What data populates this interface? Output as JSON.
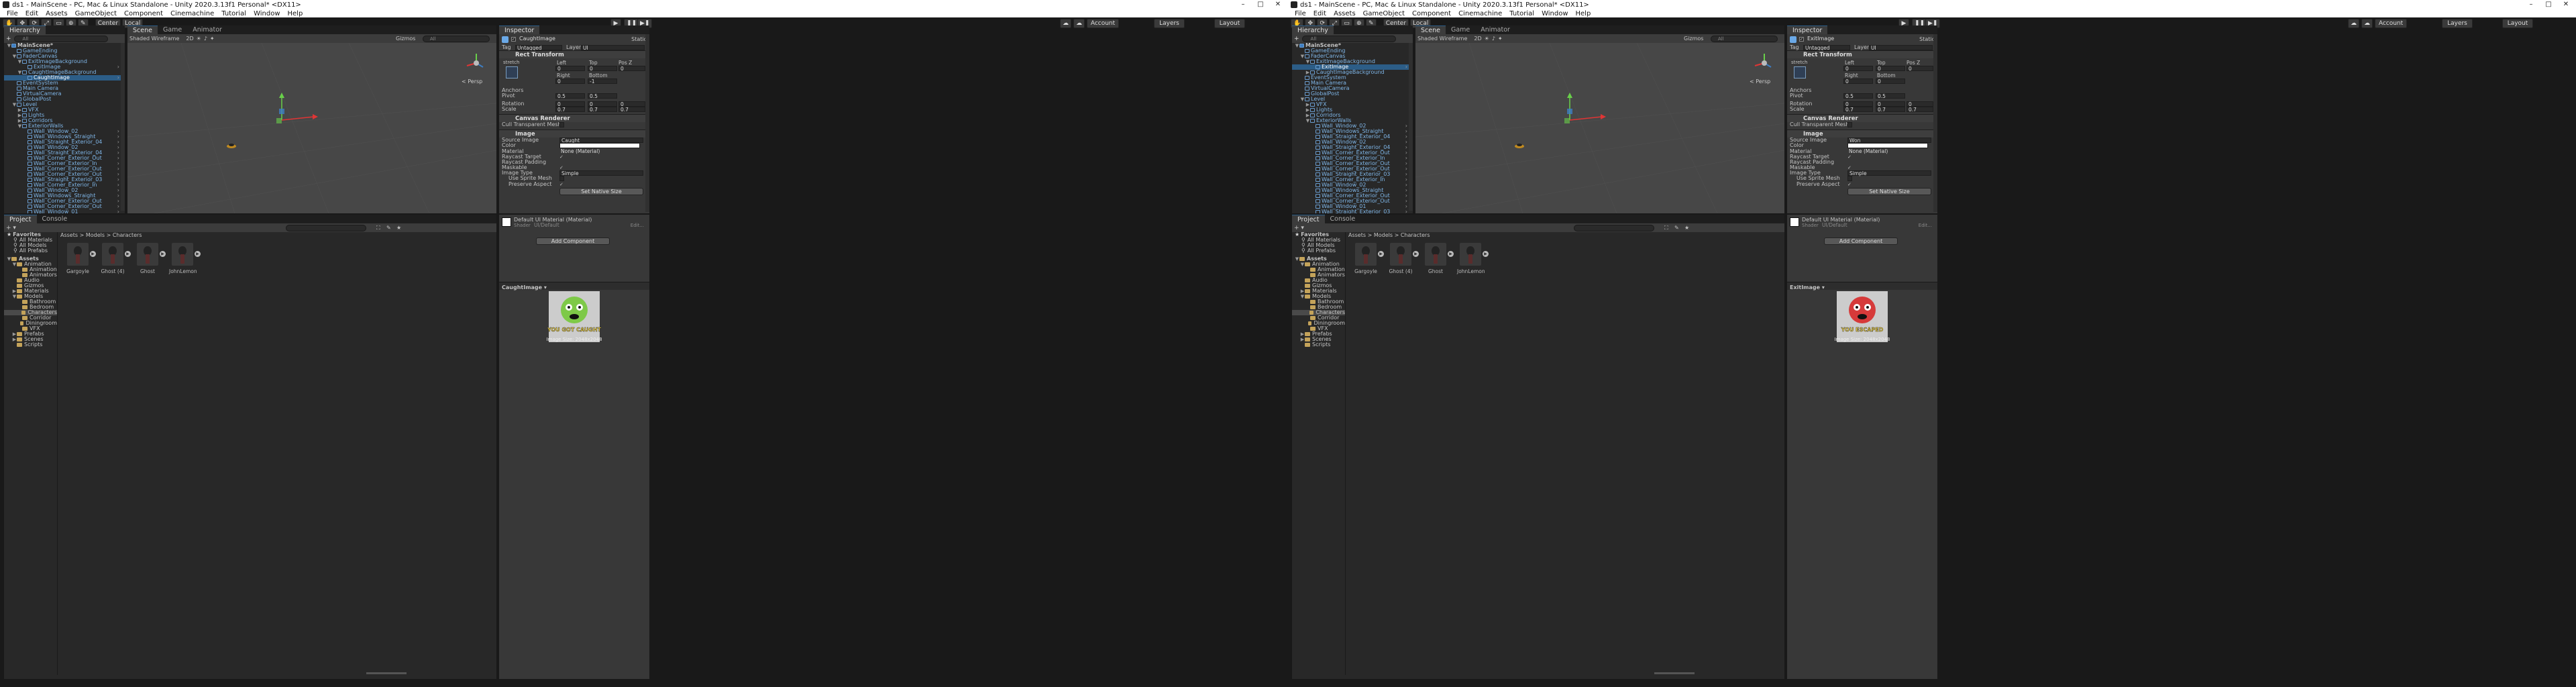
{
  "screens": [
    {
      "title": "ds1 - MainScene - PC, Mac & Linux Standalone - Unity 2020.3.13f1 Personal* <DX11>",
      "menu": [
        "File",
        "Edit",
        "Assets",
        "GameObject",
        "Component",
        "Cinemachine",
        "Tutorial",
        "Window",
        "Help"
      ],
      "toolbar": {
        "center": "Center",
        "local": "Local",
        "account": "Account",
        "layers": "Layers",
        "layout": "Layout"
      },
      "hierarchy": {
        "tab": "Hierarchy",
        "add": "+",
        "search_placeholder": "All",
        "rows": [
          {
            "label": "MainScene*",
            "indent": 0,
            "arrow": "▼",
            "scene": true
          },
          {
            "label": "GameEnding",
            "indent": 1,
            "arrow": ""
          },
          {
            "label": "FaderCanvas",
            "indent": 1,
            "arrow": "▼"
          },
          {
            "label": "ExitImageBackground",
            "indent": 2,
            "arrow": "▼"
          },
          {
            "label": "ExitImage",
            "indent": 3,
            "arrow": ""
          },
          {
            "label": "CaughtImageBackground",
            "indent": 2,
            "arrow": "▼"
          },
          {
            "label": "CaughtImage",
            "indent": 3,
            "arrow": "",
            "selected": true
          },
          {
            "label": "EventSystem",
            "indent": 1,
            "arrow": ""
          },
          {
            "label": "Main Camera",
            "indent": 1,
            "arrow": ""
          },
          {
            "label": "VirtualCamera",
            "indent": 1,
            "arrow": ""
          },
          {
            "label": "GlobalPost",
            "indent": 1,
            "arrow": ""
          },
          {
            "label": "Level",
            "indent": 1,
            "arrow": "▼"
          },
          {
            "label": "VFX",
            "indent": 2,
            "arrow": "▶"
          },
          {
            "label": "Lights",
            "indent": 2,
            "arrow": "▶"
          },
          {
            "label": "Corridors",
            "indent": 2,
            "arrow": "▶"
          },
          {
            "label": "ExteriorWalls",
            "indent": 2,
            "arrow": "▼"
          },
          {
            "label": "Wall_Window_02",
            "indent": 3,
            "arrow": ""
          },
          {
            "label": "Wall_Windows_Straight",
            "indent": 3,
            "arrow": ""
          },
          {
            "label": "Wall_Straight_Exterior_04",
            "indent": 3,
            "arrow": ""
          },
          {
            "label": "Wall_Window_02",
            "indent": 3,
            "arrow": ""
          },
          {
            "label": "Wall_Straight_Exterior_04",
            "indent": 3,
            "arrow": ""
          },
          {
            "label": "Wall_Corner_Exterior_Out",
            "indent": 3,
            "arrow": ""
          },
          {
            "label": "Wall_Corner_Exterior_In",
            "indent": 3,
            "arrow": ""
          },
          {
            "label": "Wall_Corner_Exterior_Out",
            "indent": 3,
            "arrow": ""
          },
          {
            "label": "Wall_Corner_Exterior_Out",
            "indent": 3,
            "arrow": ""
          },
          {
            "label": "Wall_Straight_Exterior_03",
            "indent": 3,
            "arrow": ""
          },
          {
            "label": "Wall_Corner_Exterior_In",
            "indent": 3,
            "arrow": ""
          },
          {
            "label": "Wall_Window_02",
            "indent": 3,
            "arrow": ""
          },
          {
            "label": "Wall_Windows_Straight",
            "indent": 3,
            "arrow": ""
          },
          {
            "label": "Wall_Corner_Exterior_Out",
            "indent": 3,
            "arrow": ""
          },
          {
            "label": "Wall_Corner_Exterior_Out",
            "indent": 3,
            "arrow": ""
          },
          {
            "label": "Wall_Window_01",
            "indent": 3,
            "arrow": ""
          }
        ]
      },
      "scene": {
        "tabs": [
          "Scene",
          "Game",
          "Animator"
        ],
        "shading": "Shaded Wireframe",
        "mode2d": "2D",
        "gizmos": "Gizmos",
        "search": "All",
        "persp": "< Persp"
      },
      "inspector": {
        "tab": "Inspector",
        "static_label": "Static",
        "object_name": "CaughtImage",
        "tag": "Untagged",
        "layer": "UI",
        "rect_transform": "Rect Transform",
        "stretch": "stretch",
        "left": "0",
        "top": "0",
        "posz": "0",
        "right": "0",
        "bottom": "-1",
        "labels": {
          "left": "Left",
          "top": "Top",
          "posz": "Pos Z",
          "right": "Right",
          "bottom": "Bottom",
          "anchors": "Anchors",
          "pivot": "Pivot",
          "rotation": "Rotation",
          "scale": "Scale",
          "x": "X",
          "y": "Y",
          "z": "Z"
        },
        "pivot_x": "0.5",
        "pivot_y": "0.5",
        "rot_x": "0",
        "rot_y": "0",
        "rot_z": "0",
        "scale_x": "0.7",
        "scale_y": "0.7",
        "scale_z": "0.7",
        "canvas_renderer": "Canvas Renderer",
        "cull_mesh": "Cull Transparent Mesh",
        "image": "Image",
        "fields": {
          "source": "Source Image",
          "color": "Color",
          "material": "Material",
          "raycast_target": "Raycast Target",
          "raycast_padding": "Raycast Padding",
          "maskable": "Maskable",
          "image_type": "Image Type",
          "use_sprite_mesh": "Use Sprite Mesh",
          "preserve_aspect": "Preserve Aspect"
        },
        "source_value": "Caught",
        "material_value": "None (Material)",
        "image_type_value": "Simple",
        "set_native": "Set Native Size",
        "default_material": "Default UI Material (Material)",
        "shader_label": "Shader",
        "shader_value": "UI/Default",
        "edit": "Edit...",
        "add_component": "Add Component",
        "preview_title": "CaughtImage ▾",
        "preview_caption": "Image Size: 2048x2048",
        "preview_art_text": "YOU GOT CAUGHT",
        "preview_color": "#7ec948"
      },
      "project": {
        "tabs": [
          "Project",
          "Console"
        ],
        "breadcrumb": [
          "Assets",
          "Models",
          "Characters"
        ],
        "favorites": "Favorites",
        "fav_items": [
          "All Materials",
          "All Models",
          "All Prefabs"
        ],
        "tree": [
          {
            "label": "Assets",
            "indent": 0,
            "arrow": "▼"
          },
          {
            "label": "Animation",
            "indent": 1,
            "arrow": "▼"
          },
          {
            "label": "Animation",
            "indent": 2,
            "arrow": ""
          },
          {
            "label": "Animators",
            "indent": 2,
            "arrow": ""
          },
          {
            "label": "Audio",
            "indent": 1,
            "arrow": ""
          },
          {
            "label": "Gizmos",
            "indent": 1,
            "arrow": ""
          },
          {
            "label": "Materials",
            "indent": 1,
            "arrow": "▶"
          },
          {
            "label": "Models",
            "indent": 1,
            "arrow": "▼"
          },
          {
            "label": "Bathroom",
            "indent": 2,
            "arrow": ""
          },
          {
            "label": "Bedroom",
            "indent": 2,
            "arrow": ""
          },
          {
            "label": "Characters",
            "indent": 2,
            "arrow": "",
            "selected": true
          },
          {
            "label": "Corridor",
            "indent": 2,
            "arrow": ""
          },
          {
            "label": "Diningroom",
            "indent": 2,
            "arrow": ""
          },
          {
            "label": "VFX",
            "indent": 2,
            "arrow": ""
          },
          {
            "label": "Prefabs",
            "indent": 1,
            "arrow": "▶"
          },
          {
            "label": "Scenes",
            "indent": 1,
            "arrow": "▶"
          },
          {
            "label": "Scripts",
            "indent": 1,
            "arrow": ""
          }
        ],
        "assets": [
          "Gargoyle",
          "Ghost (4)",
          "Ghost",
          "JohnLemon"
        ]
      }
    },
    {
      "title": "ds1 - MainScene - PC, Mac & Linux Standalone - Unity 2020.3.13f1 Personal* <DX11>",
      "menu": [
        "File",
        "Edit",
        "Assets",
        "GameObject",
        "Component",
        "Cinemachine",
        "Tutorial",
        "Window",
        "Help"
      ],
      "toolbar": {
        "center": "Center",
        "local": "Local",
        "account": "Account",
        "layers": "Layers",
        "layout": "Layout"
      },
      "hierarchy": {
        "tab": "Hierarchy",
        "add": "+",
        "search_placeholder": "All",
        "rows": [
          {
            "label": "MainScene*",
            "indent": 0,
            "arrow": "▼",
            "scene": true
          },
          {
            "label": "GameEnding",
            "indent": 1,
            "arrow": ""
          },
          {
            "label": "FaderCanvas",
            "indent": 1,
            "arrow": "▼"
          },
          {
            "label": "ExitImageBackground",
            "indent": 2,
            "arrow": "▼"
          },
          {
            "label": "ExitImage",
            "indent": 3,
            "arrow": "",
            "selected": true
          },
          {
            "label": "CaughtImageBackground",
            "indent": 2,
            "arrow": "▶"
          },
          {
            "label": "EventSystem",
            "indent": 1,
            "arrow": ""
          },
          {
            "label": "Main Camera",
            "indent": 1,
            "arrow": ""
          },
          {
            "label": "VirtualCamera",
            "indent": 1,
            "arrow": ""
          },
          {
            "label": "GlobalPost",
            "indent": 1,
            "arrow": ""
          },
          {
            "label": "Level",
            "indent": 1,
            "arrow": "▼"
          },
          {
            "label": "VFX",
            "indent": 2,
            "arrow": "▶"
          },
          {
            "label": "Lights",
            "indent": 2,
            "arrow": "▶"
          },
          {
            "label": "Corridors",
            "indent": 2,
            "arrow": "▶"
          },
          {
            "label": "ExteriorWalls",
            "indent": 2,
            "arrow": "▼"
          },
          {
            "label": "Wall_Window_02",
            "indent": 3,
            "arrow": ""
          },
          {
            "label": "Wall_Windows_Straight",
            "indent": 3,
            "arrow": ""
          },
          {
            "label": "Wall_Straight_Exterior_04",
            "indent": 3,
            "arrow": ""
          },
          {
            "label": "Wall_Window_02",
            "indent": 3,
            "arrow": ""
          },
          {
            "label": "Wall_Straight_Exterior_04",
            "indent": 3,
            "arrow": ""
          },
          {
            "label": "Wall_Corner_Exterior_Out",
            "indent": 3,
            "arrow": ""
          },
          {
            "label": "Wall_Corner_Exterior_In",
            "indent": 3,
            "arrow": ""
          },
          {
            "label": "Wall_Corner_Exterior_Out",
            "indent": 3,
            "arrow": ""
          },
          {
            "label": "Wall_Corner_Exterior_Out",
            "indent": 3,
            "arrow": ""
          },
          {
            "label": "Wall_Straight_Exterior_03",
            "indent": 3,
            "arrow": ""
          },
          {
            "label": "Wall_Corner_Exterior_In",
            "indent": 3,
            "arrow": ""
          },
          {
            "label": "Wall_Window_02",
            "indent": 3,
            "arrow": ""
          },
          {
            "label": "Wall_Windows_Straight",
            "indent": 3,
            "arrow": ""
          },
          {
            "label": "Wall_Corner_Exterior_Out",
            "indent": 3,
            "arrow": ""
          },
          {
            "label": "Wall_Corner_Exterior_Out",
            "indent": 3,
            "arrow": ""
          },
          {
            "label": "Wall_Window_01",
            "indent": 3,
            "arrow": ""
          },
          {
            "label": "Wall_Straight_Exterior_03",
            "indent": 3,
            "arrow": ""
          }
        ]
      },
      "scene": {
        "tabs": [
          "Scene",
          "Game",
          "Animator"
        ],
        "shading": "Shaded Wireframe",
        "mode2d": "2D",
        "gizmos": "Gizmos",
        "search": "All",
        "persp": "< Persp"
      },
      "inspector": {
        "tab": "Inspector",
        "static_label": "Static",
        "object_name": "ExitImage",
        "tag": "Untagged",
        "layer": "UI",
        "rect_transform": "Rect Transform",
        "stretch": "stretch",
        "left": "0",
        "top": "0",
        "posz": "0",
        "right": "0",
        "bottom": "0",
        "labels": {
          "left": "Left",
          "top": "Top",
          "posz": "Pos Z",
          "right": "Right",
          "bottom": "Bottom",
          "anchors": "Anchors",
          "pivot": "Pivot",
          "rotation": "Rotation",
          "scale": "Scale",
          "x": "X",
          "y": "Y",
          "z": "Z"
        },
        "pivot_x": "0.5",
        "pivot_y": "0.5",
        "rot_x": "0",
        "rot_y": "0",
        "rot_z": "0",
        "scale_x": "0.7",
        "scale_y": "0.7",
        "scale_z": "0.7",
        "canvas_renderer": "Canvas Renderer",
        "cull_mesh": "Cull Transparent Mesh",
        "image": "Image",
        "fields": {
          "source": "Source Image",
          "color": "Color",
          "material": "Material",
          "raycast_target": "Raycast Target",
          "raycast_padding": "Raycast Padding",
          "maskable": "Maskable",
          "image_type": "Image Type",
          "use_sprite_mesh": "Use Sprite Mesh",
          "preserve_aspect": "Preserve Aspect"
        },
        "source_value": "Won",
        "material_value": "None (Material)",
        "image_type_value": "Simple",
        "set_native": "Set Native Size",
        "default_material": "Default UI Material (Material)",
        "shader_label": "Shader",
        "shader_value": "UI/Default",
        "edit": "Edit...",
        "add_component": "Add Component",
        "preview_title": "ExitImage ▾",
        "preview_caption": "Image Size: 2048x2048",
        "preview_art_text": "YOU ESCAPED",
        "preview_color": "#d63a3a"
      },
      "project": {
        "tabs": [
          "Project",
          "Console"
        ],
        "breadcrumb": [
          "Assets",
          "Models",
          "Characters"
        ],
        "favorites": "Favorites",
        "fav_items": [
          "All Materials",
          "All Models",
          "All Prefabs"
        ],
        "tree": [
          {
            "label": "Assets",
            "indent": 0,
            "arrow": "▼"
          },
          {
            "label": "Animation",
            "indent": 1,
            "arrow": "▼"
          },
          {
            "label": "Animation",
            "indent": 2,
            "arrow": ""
          },
          {
            "label": "Animators",
            "indent": 2,
            "arrow": ""
          },
          {
            "label": "Audio",
            "indent": 1,
            "arrow": ""
          },
          {
            "label": "Gizmos",
            "indent": 1,
            "arrow": ""
          },
          {
            "label": "Materials",
            "indent": 1,
            "arrow": "▶"
          },
          {
            "label": "Models",
            "indent": 1,
            "arrow": "▼"
          },
          {
            "label": "Bathroom",
            "indent": 2,
            "arrow": ""
          },
          {
            "label": "Bedroom",
            "indent": 2,
            "arrow": ""
          },
          {
            "label": "Characters",
            "indent": 2,
            "arrow": "",
            "selected": true
          },
          {
            "label": "Corridor",
            "indent": 2,
            "arrow": ""
          },
          {
            "label": "Diningroom",
            "indent": 2,
            "arrow": ""
          },
          {
            "label": "VFX",
            "indent": 2,
            "arrow": ""
          },
          {
            "label": "Prefabs",
            "indent": 1,
            "arrow": "▶"
          },
          {
            "label": "Scenes",
            "indent": 1,
            "arrow": "▶"
          },
          {
            "label": "Scripts",
            "indent": 1,
            "arrow": ""
          }
        ],
        "assets": [
          "Gargoyle",
          "Ghost (4)",
          "Ghost",
          "JohnLemon"
        ]
      }
    }
  ],
  "colors": {
    "selection": "#2c5d87",
    "panel": "#282828",
    "inspector": "#383838",
    "scene": "#474747"
  }
}
